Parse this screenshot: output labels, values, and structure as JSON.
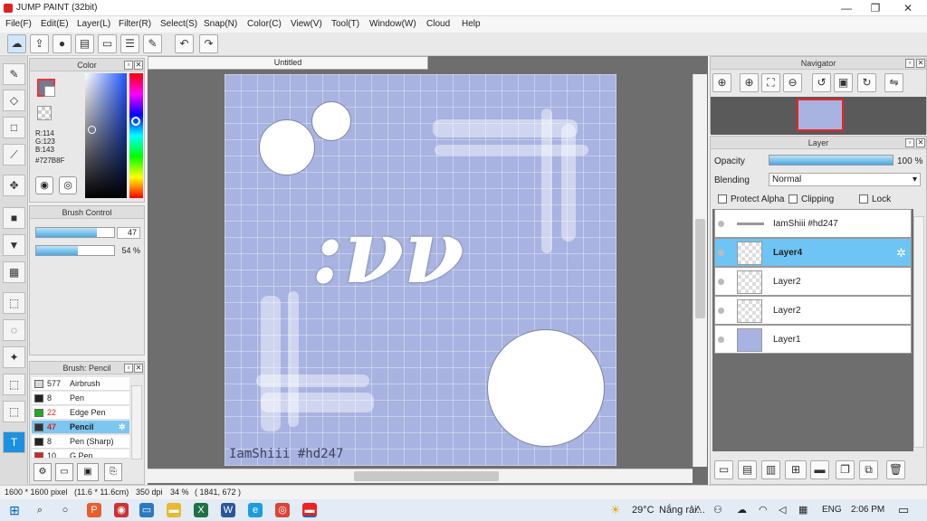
{
  "window": {
    "title": "JUMP PAINT (32bit)",
    "minimize": "—",
    "restore": "❐",
    "close": "✕"
  },
  "menu": [
    "File(F)",
    "Edit(E)",
    "Layer(L)",
    "Filter(R)",
    "Select(S)",
    "Snap(N)",
    "Color(C)",
    "View(V)",
    "Tool(T)",
    "Window(W)",
    "Cloud",
    "Help"
  ],
  "color_panel": {
    "title": "Color",
    "r": "R:114",
    "g": "G:123",
    "b": "B:143",
    "hex": "#727B8F",
    "main_color": "#727b8f"
  },
  "brush_control": {
    "title": "Brush Control",
    "size": "47",
    "size_level": 0.78,
    "opacity": "54 %",
    "opacity_level": 0.54
  },
  "brush_list": {
    "title": "Brush: Pencil",
    "items": [
      {
        "size": "577",
        "name": "Airbrush",
        "color": "#d8d8d8"
      },
      {
        "size": "8",
        "name": "Pen",
        "color": "#222222"
      },
      {
        "size": "22",
        "name": "Edge Pen",
        "color": "#22aa22"
      },
      {
        "size": "47",
        "name": "Pencil",
        "color": "#333333"
      },
      {
        "size": "8",
        "name": "Pen (Sharp)",
        "color": "#222222"
      },
      {
        "size": "10",
        "name": "G Pen",
        "color": "#dd2222"
      }
    ]
  },
  "document": {
    "tab": "Untitled",
    "signature": "IamShiii #hd247",
    "art_text": ":νν"
  },
  "navigator": {
    "title": "Navigator"
  },
  "layer_panel": {
    "title": "Layer",
    "opacity_label": "Opacity",
    "opacity_value": "100 %",
    "opacity_level": 1.0,
    "blending_label": "Blending",
    "blending_value": "Normal",
    "protect_alpha": "Protect Alpha",
    "clipping": "Clipping",
    "lock": "Lock",
    "layers": [
      {
        "name": "IamShiii #hd247"
      },
      {
        "name": "Layer4"
      },
      {
        "name": "Layer2"
      },
      {
        "name": "Layer2"
      },
      {
        "name": "Layer1"
      }
    ]
  },
  "status": {
    "size": "1600 * 1600 pixel",
    "cm": "(11.6 * 11.6cm)",
    "dpi": "350 dpi",
    "zoom": "34 %",
    "coords": "( 1841, 672 )"
  },
  "taskbar": {
    "temp": "29°C",
    "weather": "Nắng rải...",
    "lang": "ENG",
    "time": "2:06 PM"
  }
}
